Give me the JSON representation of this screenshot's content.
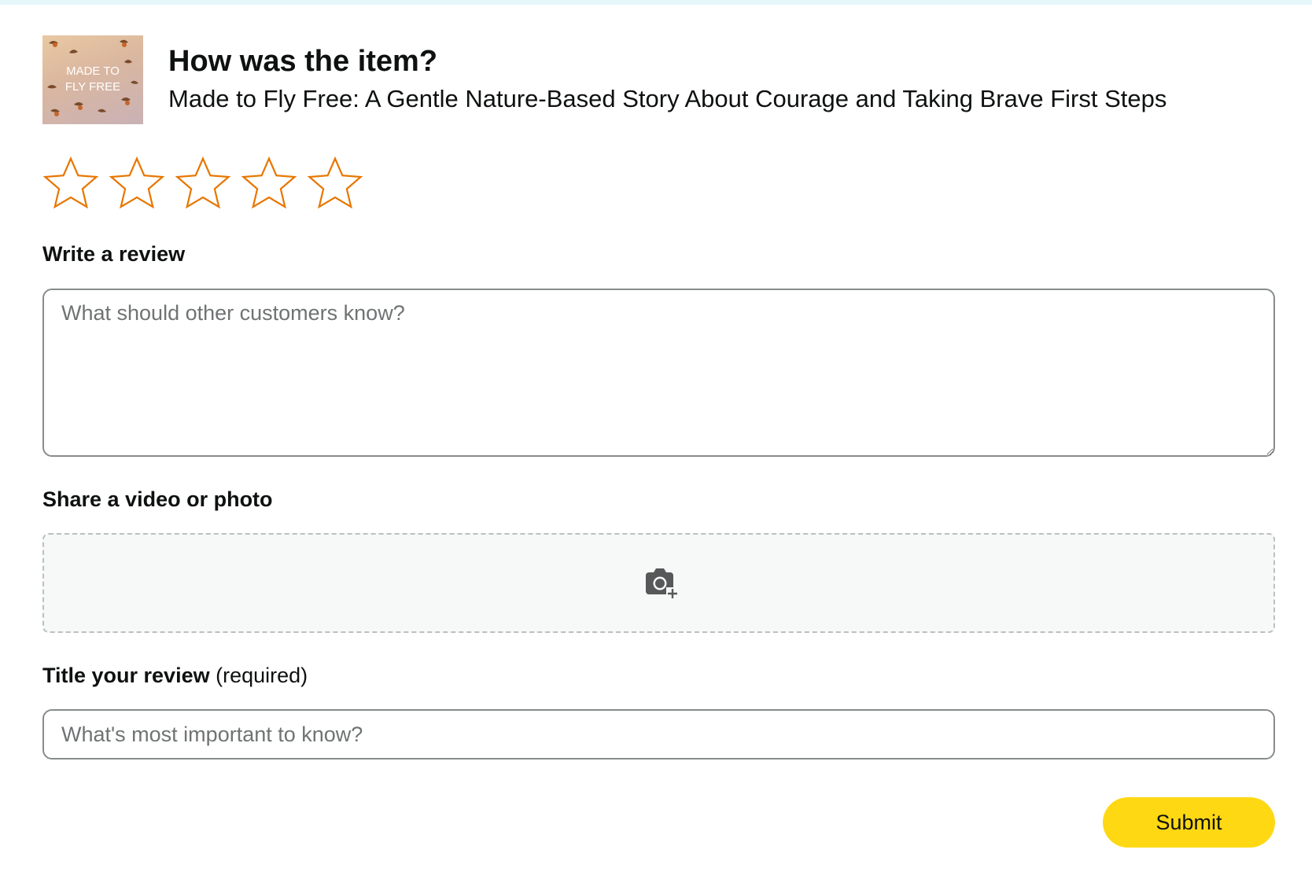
{
  "header": {
    "question": "How was the item?",
    "product_title": "Made to Fly Free: A Gentle Nature-Based Story About Courage and Taking Brave First Steps",
    "thumbnail_text_line1": "MADE TO",
    "thumbnail_text_line2": "FLY FREE"
  },
  "rating": {
    "max_stars": 5,
    "selected": 0,
    "star_color": "#e77600",
    "star_icons": [
      "star-outline-icon",
      "star-outline-icon",
      "star-outline-icon",
      "star-outline-icon",
      "star-outline-icon"
    ]
  },
  "review": {
    "label": "Write a review",
    "placeholder": "What should other customers know?",
    "value": ""
  },
  "media": {
    "label": "Share a video or photo",
    "icon": "camera-add-icon"
  },
  "title_field": {
    "label": "Title your review",
    "required_note": "(required)",
    "placeholder": "What's most important to know?",
    "value": ""
  },
  "submit": {
    "label": "Submit",
    "color": "#ffd814"
  }
}
